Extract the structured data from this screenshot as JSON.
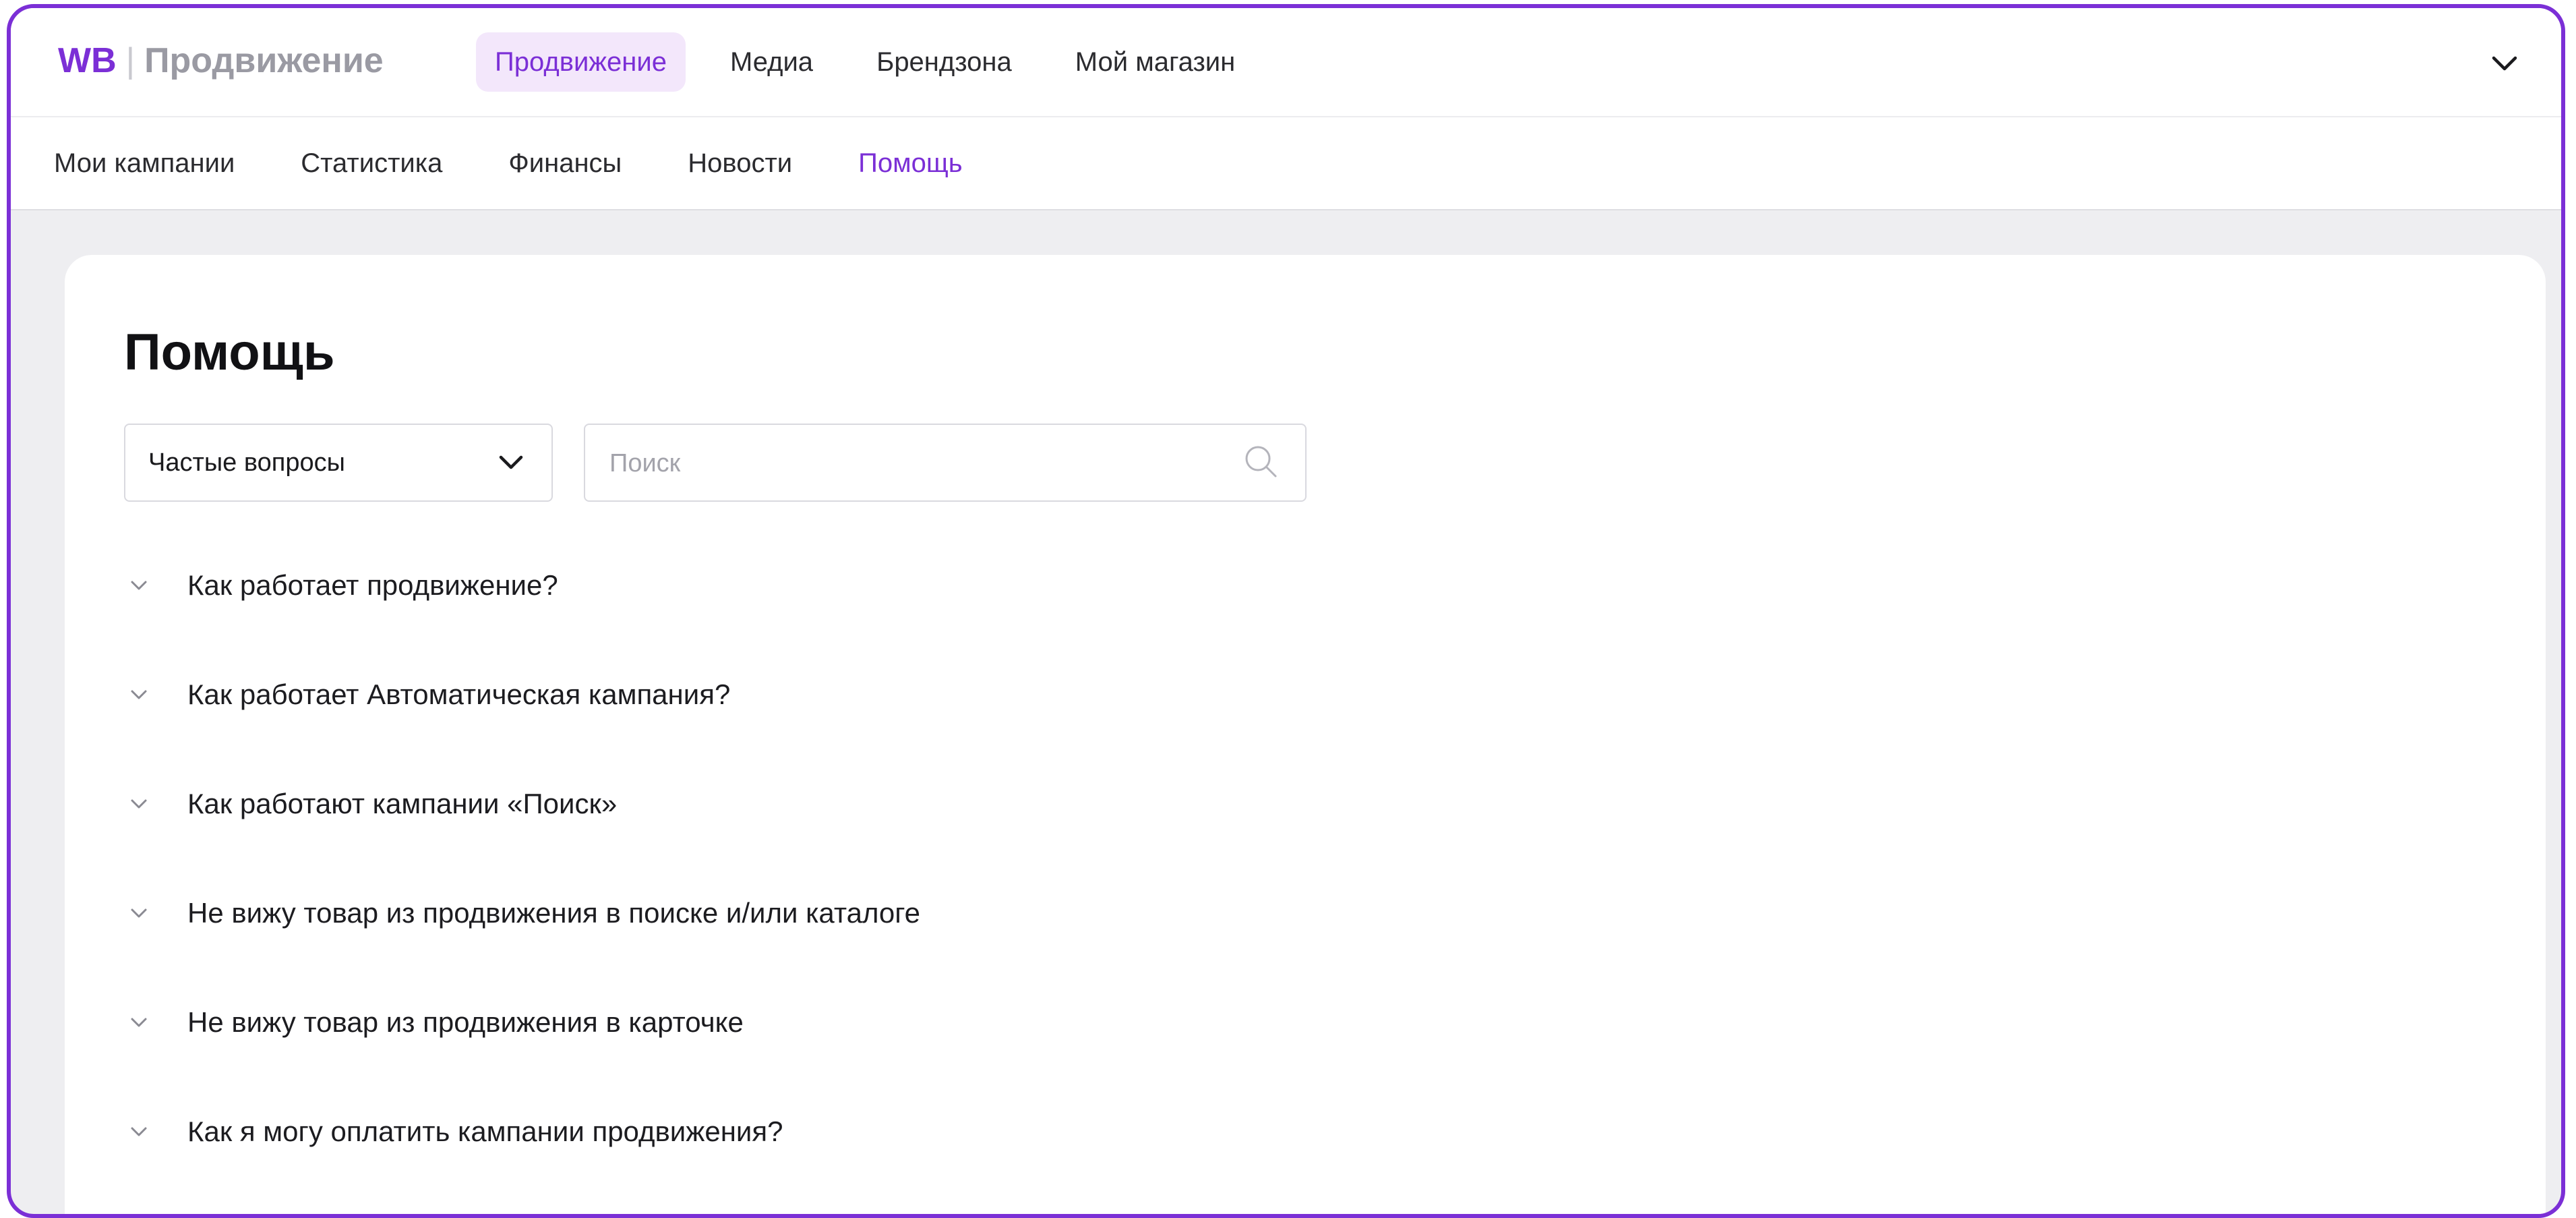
{
  "header": {
    "logo_brand": "WB",
    "logo_separator": "|",
    "logo_product": "Продвижение",
    "nav": [
      {
        "label": "Продвижение",
        "active": true
      },
      {
        "label": "Медиа",
        "active": false
      },
      {
        "label": "Брендзона",
        "active": false
      },
      {
        "label": "Мой магазин",
        "active": false
      }
    ],
    "menu_icon": "chevron-down-icon"
  },
  "subnav": [
    {
      "label": "Мои кампании",
      "active": false
    },
    {
      "label": "Статистика",
      "active": false
    },
    {
      "label": "Финансы",
      "active": false
    },
    {
      "label": "Новости",
      "active": false
    },
    {
      "label": "Помощь",
      "active": true
    }
  ],
  "main": {
    "title": "Помощь",
    "category_select": {
      "value": "Частые вопросы",
      "icon": "chevron-down-icon"
    },
    "search": {
      "placeholder": "Поиск",
      "value": "",
      "icon": "search-icon"
    },
    "faq": [
      "Как работает продвижение?",
      "Как работает Автоматическая кампания?",
      "Как работают кампании «Поиск»",
      "Не вижу товар из продвижения в поиске и/или каталоге",
      "Не вижу товар из продвижения в карточке",
      "Как я могу оплатить кампании продвижения?"
    ]
  },
  "colors": {
    "accent": "#7b2fd6",
    "accent_bg": "#f3e7fb",
    "page_bg": "#eeeef1",
    "text": "#1c1c20"
  }
}
